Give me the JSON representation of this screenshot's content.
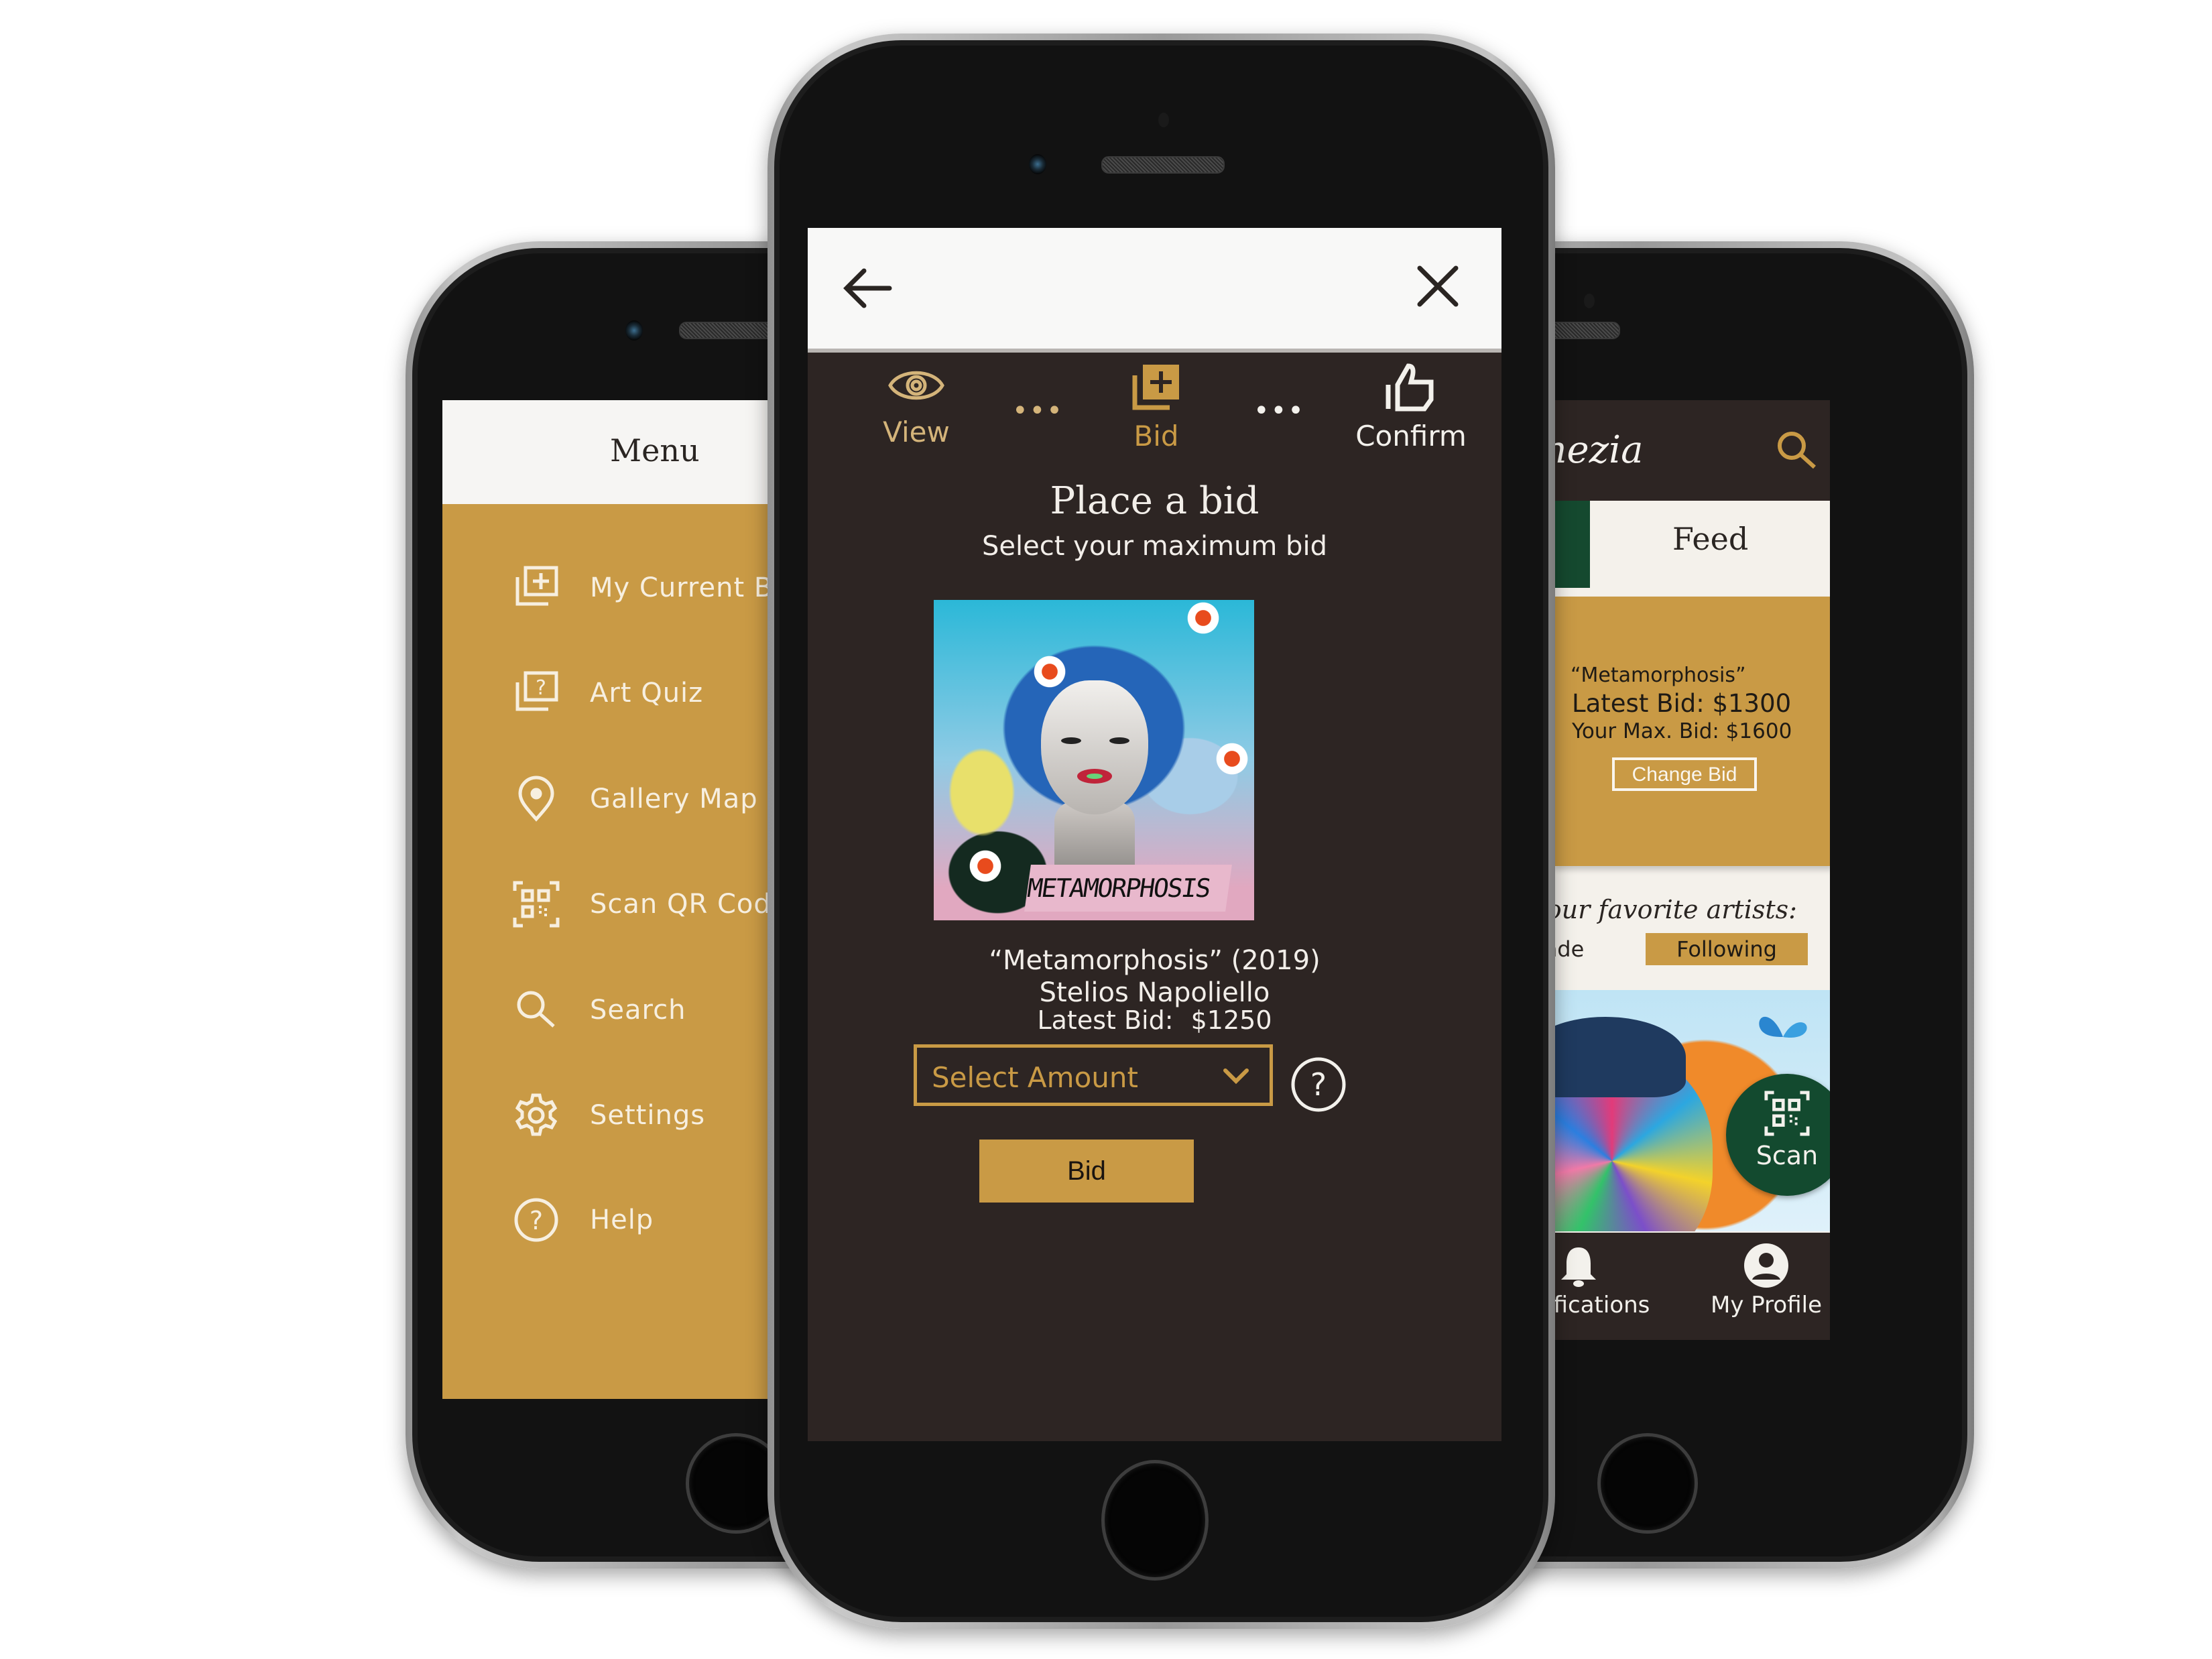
{
  "colors": {
    "gold": "#c99a45",
    "dark_brown": "#2d2523",
    "green": "#134a2f",
    "offwhite": "#f8f8f7"
  },
  "left_phone": {
    "title": "Menu",
    "items": [
      {
        "label": "My Current Bids",
        "icon": "bid-stack-icon"
      },
      {
        "label": "Art Quiz",
        "icon": "quiz-stack-icon"
      },
      {
        "label": "Gallery Map",
        "icon": "map-pin-icon"
      },
      {
        "label": "Scan QR Code",
        "icon": "qr-scan-icon"
      },
      {
        "label": "Search",
        "icon": "search-icon"
      },
      {
        "label": "Settings",
        "icon": "gear-icon"
      },
      {
        "label": "Help",
        "icon": "help-icon"
      }
    ]
  },
  "center_phone": {
    "back_icon": "arrow-left-icon",
    "close_icon": "close-icon",
    "steps": [
      {
        "label": "View",
        "icon": "eye-icon",
        "state": "done"
      },
      {
        "label": "Bid",
        "icon": "bid-stack-icon",
        "state": "active"
      },
      {
        "label": "Confirm",
        "icon": "thumbs-up-icon",
        "state": "upcoming"
      }
    ],
    "step_separator": "•••",
    "title": "Place a bid",
    "subtitle": "Select your maximum bid",
    "artwork": {
      "image_text": "METAMORPHOSIS",
      "title_line": "“Metamorphosis” (2019)",
      "artist": "Stelios Napoliello"
    },
    "latest_bid_label": "Latest Bid:",
    "latest_bid_value": "$1250",
    "select": {
      "placeholder": "Select Amount"
    },
    "help_icon": "help-circle-icon",
    "bid_button": "Bid"
  },
  "right_phone": {
    "logo": "Venezia",
    "search_icon": "search-icon",
    "tab_label": "Feed",
    "bid_card": {
      "artwork": "“Metamorphosis”",
      "latest_bid": "Latest Bid: $1300",
      "max_bid": "Your Max. Bid: $1600",
      "button": "Change Bid"
    },
    "favorites_label": "Your favorite artists:",
    "artist_partial": "nde",
    "follow_button": "Following",
    "scan_button": "Scan",
    "bottom_nav": [
      {
        "label": "Notifications",
        "icon": "bell-icon"
      },
      {
        "label": "My Profile",
        "icon": "profile-icon"
      }
    ]
  }
}
